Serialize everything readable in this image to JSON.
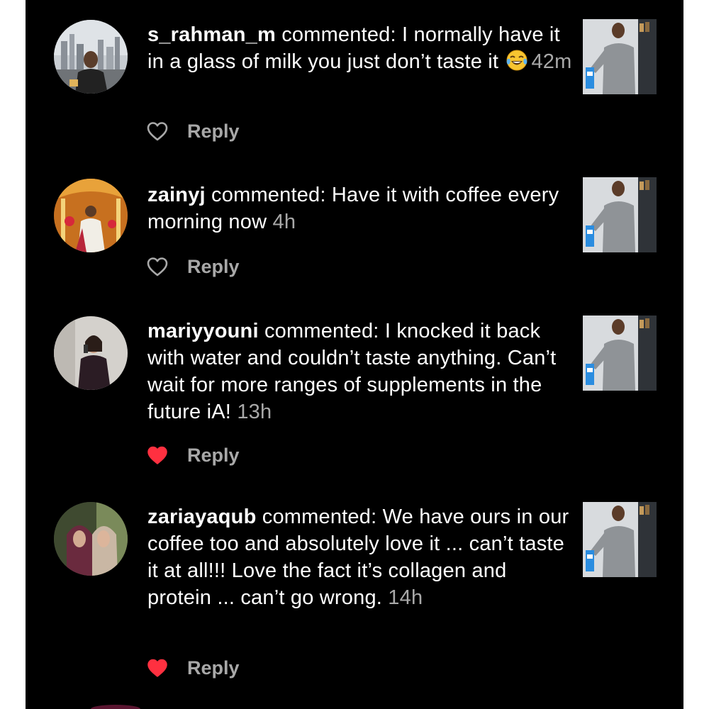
{
  "comments": [
    {
      "username": "s_rahman_m",
      "verb": " commented: ",
      "text_before_emoji": "I normally have it in a glass of milk you just don’t taste it ",
      "emoji_icon": "face-with-tears-of-joy-emoji",
      "time": "42m",
      "liked": false,
      "reply_label": "Reply"
    },
    {
      "username": "zainyj",
      "verb": " commented: ",
      "text": "Have it with coffee every morning now ",
      "time": "4h",
      "liked": false,
      "reply_label": "Reply"
    },
    {
      "username": "mariyyouni",
      "verb": " commented: ",
      "text": "I knocked it back with water and couldn’t taste anything. Can’t wait for more ranges of supplements in the future iA! ",
      "time": "13h",
      "liked": true,
      "reply_label": "Reply"
    },
    {
      "username": "zariayaqub",
      "verb": " commented: ",
      "text": "We have ours in our coffee too and absolutely love it ... can’t taste it at all!!! Love the fact it’s collagen and protein ... can’t go wrong. ",
      "time": "14h",
      "liked": true,
      "reply_label": "Reply"
    }
  ],
  "colors": {
    "background": "#000000",
    "text": "#ffffff",
    "muted": "#a8a8a8",
    "like_red": "#ff3040"
  }
}
